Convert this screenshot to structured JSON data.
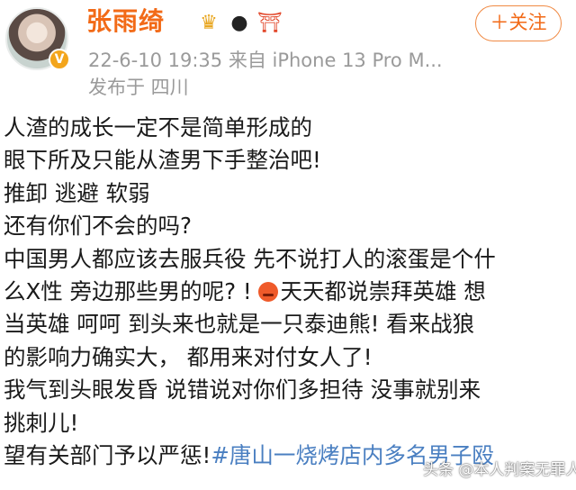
{
  "post": {
    "username": "张雨绮",
    "badges": [
      "crown-icon",
      "panda-icon",
      "torii-icon"
    ],
    "meta": "22-6-10 19:35  来自 iPhone 13 Pro M...",
    "location": "发布于 四川",
    "follow_label": "＋关注",
    "verified_mark": "V"
  },
  "content": {
    "line1": "人渣的成长一定不是简单形成的",
    "line2": "眼下所及只能从渣男下手整治吧!",
    "line3": "推卸 逃避 软弱",
    "line4": "还有你们不会的吗?",
    "line5": "中国男人都应该去服兵役 先不说打人的滚蛋是个什",
    "line6": "么X性 旁边那些男的呢? !",
    "line6b": "天天都说崇拜英雄 想",
    "line7": "当英雄 呵呵 到头来也就是一只泰迪熊! 看来战狼",
    "line8": "的影响力确实大， 都用来对付女人了!",
    "line9": "我气到头眼发昏 说错说对你们多担待 没事就别来",
    "line10": "挑刺儿!",
    "line11_text": "望有关部门予以严惩!",
    "line11_topic": "#唐山一烧烤店内多名男子殴"
  },
  "watermark": "头条 @本人判案无罪人"
}
